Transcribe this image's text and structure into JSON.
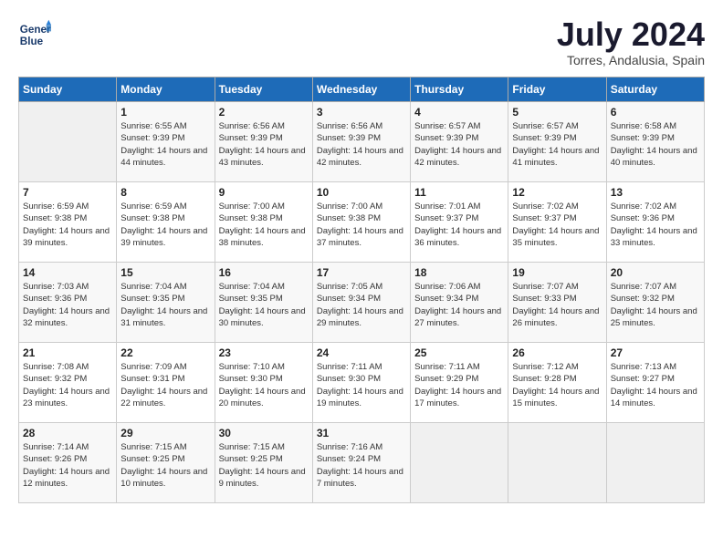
{
  "header": {
    "logo_line1": "General",
    "logo_line2": "Blue",
    "month_year": "July 2024",
    "location": "Torres, Andalusia, Spain"
  },
  "weekdays": [
    "Sunday",
    "Monday",
    "Tuesday",
    "Wednesday",
    "Thursday",
    "Friday",
    "Saturday"
  ],
  "weeks": [
    [
      {
        "day": "",
        "sunrise": "",
        "sunset": "",
        "daylight": ""
      },
      {
        "day": "1",
        "sunrise": "Sunrise: 6:55 AM",
        "sunset": "Sunset: 9:39 PM",
        "daylight": "Daylight: 14 hours and 44 minutes."
      },
      {
        "day": "2",
        "sunrise": "Sunrise: 6:56 AM",
        "sunset": "Sunset: 9:39 PM",
        "daylight": "Daylight: 14 hours and 43 minutes."
      },
      {
        "day": "3",
        "sunrise": "Sunrise: 6:56 AM",
        "sunset": "Sunset: 9:39 PM",
        "daylight": "Daylight: 14 hours and 42 minutes."
      },
      {
        "day": "4",
        "sunrise": "Sunrise: 6:57 AM",
        "sunset": "Sunset: 9:39 PM",
        "daylight": "Daylight: 14 hours and 42 minutes."
      },
      {
        "day": "5",
        "sunrise": "Sunrise: 6:57 AM",
        "sunset": "Sunset: 9:39 PM",
        "daylight": "Daylight: 14 hours and 41 minutes."
      },
      {
        "day": "6",
        "sunrise": "Sunrise: 6:58 AM",
        "sunset": "Sunset: 9:39 PM",
        "daylight": "Daylight: 14 hours and 40 minutes."
      }
    ],
    [
      {
        "day": "7",
        "sunrise": "Sunrise: 6:59 AM",
        "sunset": "Sunset: 9:38 PM",
        "daylight": "Daylight: 14 hours and 39 minutes."
      },
      {
        "day": "8",
        "sunrise": "Sunrise: 6:59 AM",
        "sunset": "Sunset: 9:38 PM",
        "daylight": "Daylight: 14 hours and 39 minutes."
      },
      {
        "day": "9",
        "sunrise": "Sunrise: 7:00 AM",
        "sunset": "Sunset: 9:38 PM",
        "daylight": "Daylight: 14 hours and 38 minutes."
      },
      {
        "day": "10",
        "sunrise": "Sunrise: 7:00 AM",
        "sunset": "Sunset: 9:38 PM",
        "daylight": "Daylight: 14 hours and 37 minutes."
      },
      {
        "day": "11",
        "sunrise": "Sunrise: 7:01 AM",
        "sunset": "Sunset: 9:37 PM",
        "daylight": "Daylight: 14 hours and 36 minutes."
      },
      {
        "day": "12",
        "sunrise": "Sunrise: 7:02 AM",
        "sunset": "Sunset: 9:37 PM",
        "daylight": "Daylight: 14 hours and 35 minutes."
      },
      {
        "day": "13",
        "sunrise": "Sunrise: 7:02 AM",
        "sunset": "Sunset: 9:36 PM",
        "daylight": "Daylight: 14 hours and 33 minutes."
      }
    ],
    [
      {
        "day": "14",
        "sunrise": "Sunrise: 7:03 AM",
        "sunset": "Sunset: 9:36 PM",
        "daylight": "Daylight: 14 hours and 32 minutes."
      },
      {
        "day": "15",
        "sunrise": "Sunrise: 7:04 AM",
        "sunset": "Sunset: 9:35 PM",
        "daylight": "Daylight: 14 hours and 31 minutes."
      },
      {
        "day": "16",
        "sunrise": "Sunrise: 7:04 AM",
        "sunset": "Sunset: 9:35 PM",
        "daylight": "Daylight: 14 hours and 30 minutes."
      },
      {
        "day": "17",
        "sunrise": "Sunrise: 7:05 AM",
        "sunset": "Sunset: 9:34 PM",
        "daylight": "Daylight: 14 hours and 29 minutes."
      },
      {
        "day": "18",
        "sunrise": "Sunrise: 7:06 AM",
        "sunset": "Sunset: 9:34 PM",
        "daylight": "Daylight: 14 hours and 27 minutes."
      },
      {
        "day": "19",
        "sunrise": "Sunrise: 7:07 AM",
        "sunset": "Sunset: 9:33 PM",
        "daylight": "Daylight: 14 hours and 26 minutes."
      },
      {
        "day": "20",
        "sunrise": "Sunrise: 7:07 AM",
        "sunset": "Sunset: 9:32 PM",
        "daylight": "Daylight: 14 hours and 25 minutes."
      }
    ],
    [
      {
        "day": "21",
        "sunrise": "Sunrise: 7:08 AM",
        "sunset": "Sunset: 9:32 PM",
        "daylight": "Daylight: 14 hours and 23 minutes."
      },
      {
        "day": "22",
        "sunrise": "Sunrise: 7:09 AM",
        "sunset": "Sunset: 9:31 PM",
        "daylight": "Daylight: 14 hours and 22 minutes."
      },
      {
        "day": "23",
        "sunrise": "Sunrise: 7:10 AM",
        "sunset": "Sunset: 9:30 PM",
        "daylight": "Daylight: 14 hours and 20 minutes."
      },
      {
        "day": "24",
        "sunrise": "Sunrise: 7:11 AM",
        "sunset": "Sunset: 9:30 PM",
        "daylight": "Daylight: 14 hours and 19 minutes."
      },
      {
        "day": "25",
        "sunrise": "Sunrise: 7:11 AM",
        "sunset": "Sunset: 9:29 PM",
        "daylight": "Daylight: 14 hours and 17 minutes."
      },
      {
        "day": "26",
        "sunrise": "Sunrise: 7:12 AM",
        "sunset": "Sunset: 9:28 PM",
        "daylight": "Daylight: 14 hours and 15 minutes."
      },
      {
        "day": "27",
        "sunrise": "Sunrise: 7:13 AM",
        "sunset": "Sunset: 9:27 PM",
        "daylight": "Daylight: 14 hours and 14 minutes."
      }
    ],
    [
      {
        "day": "28",
        "sunrise": "Sunrise: 7:14 AM",
        "sunset": "Sunset: 9:26 PM",
        "daylight": "Daylight: 14 hours and 12 minutes."
      },
      {
        "day": "29",
        "sunrise": "Sunrise: 7:15 AM",
        "sunset": "Sunset: 9:25 PM",
        "daylight": "Daylight: 14 hours and 10 minutes."
      },
      {
        "day": "30",
        "sunrise": "Sunrise: 7:15 AM",
        "sunset": "Sunset: 9:25 PM",
        "daylight": "Daylight: 14 hours and 9 minutes."
      },
      {
        "day": "31",
        "sunrise": "Sunrise: 7:16 AM",
        "sunset": "Sunset: 9:24 PM",
        "daylight": "Daylight: 14 hours and 7 minutes."
      },
      {
        "day": "",
        "sunrise": "",
        "sunset": "",
        "daylight": ""
      },
      {
        "day": "",
        "sunrise": "",
        "sunset": "",
        "daylight": ""
      },
      {
        "day": "",
        "sunrise": "",
        "sunset": "",
        "daylight": ""
      }
    ]
  ]
}
